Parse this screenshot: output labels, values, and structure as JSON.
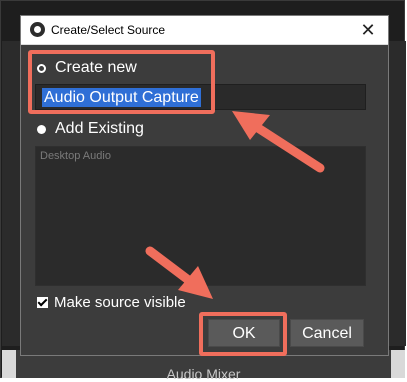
{
  "dialog": {
    "title": "Create/Select Source",
    "close_glyph": "✕",
    "create_new_label": "Create new",
    "source_name_value": "Audio Output Capture",
    "add_existing_label": "Add Existing",
    "existing_sources": [
      "Desktop Audio"
    ],
    "make_visible_label": "Make source visible",
    "make_visible_checked": true,
    "ok_label": "OK",
    "cancel_label": "Cancel"
  },
  "background": {
    "audio_mixer_label": "Audio Mixer"
  },
  "annotations": {
    "highlight_color": "#f06e5c"
  },
  "icons": [
    "obs-app-icon",
    "close-icon",
    "radio-empty-icon",
    "radio-filled-icon",
    "checkbox-checked-icon"
  ]
}
